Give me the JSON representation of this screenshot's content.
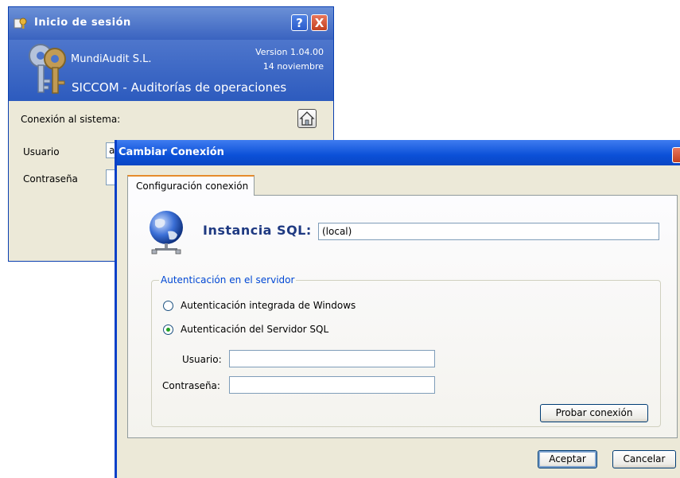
{
  "login_window": {
    "title": "Inicio de sesión",
    "help_button": "?",
    "close_button": "X",
    "company": "MundiAudit S.L.",
    "version": "Version 1.04.00",
    "date": "14 noviembre",
    "app_name": "SICCOM - Auditorías de operaciones",
    "connection_label": "Conexión al sistema:",
    "user_label": "Usuario",
    "user_value": "a",
    "password_label": "Contraseña"
  },
  "connection_dialog": {
    "title": "Cambiar Conexión",
    "tab_label": "Configuración conexión",
    "sql_instance_label": "Instancia SQL:",
    "sql_instance_value": "(local)",
    "auth_group_label": "Autenticación en el servidor",
    "auth_options": [
      {
        "label": "Autenticación integrada de Windows",
        "selected": false
      },
      {
        "label": "Autenticación del Servidor SQL",
        "selected": true
      }
    ],
    "user_label": "Usuario:",
    "user_value": "",
    "password_label": "Contraseña:",
    "password_value": "",
    "test_button": "Probar conexión",
    "accept_button": "Aceptar",
    "cancel_button": "Cancelar"
  },
  "colors": {
    "title_bar": "#0b50d8",
    "banner": "#3a63c0",
    "dialog_bg": "#ece9d8",
    "legend_text": "#0046d5",
    "sql_label_text": "#1f3a82",
    "tab_accent": "#e68b2c"
  },
  "icons": [
    "app-icon",
    "keys-logo",
    "house-icon",
    "globe-network-icon",
    "close-icon",
    "help-icon"
  ]
}
